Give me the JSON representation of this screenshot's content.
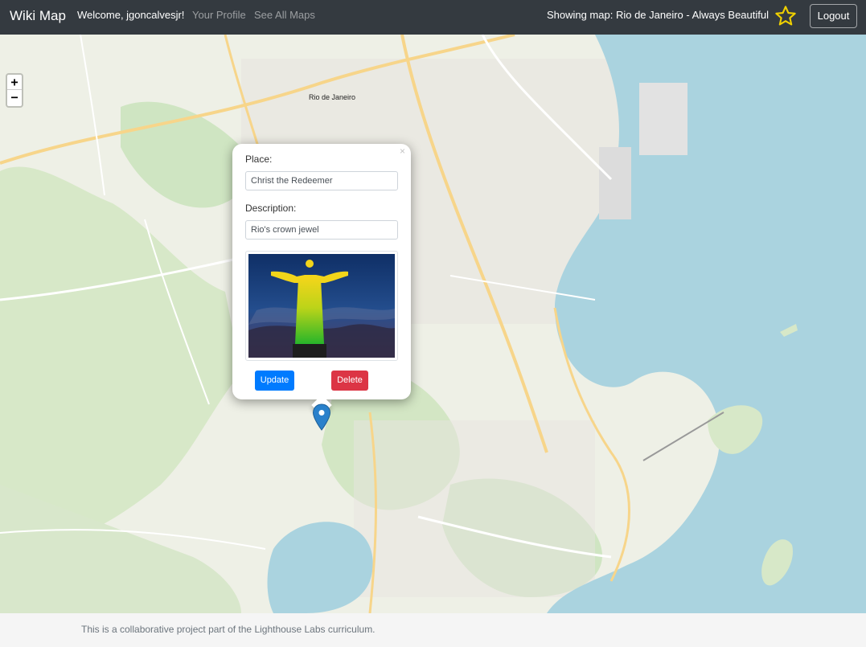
{
  "navbar": {
    "brand": "Wiki Map",
    "welcome": "Welcome, jgoncalvesjr!",
    "links": {
      "profile": "Your Profile",
      "all_maps": "See All Maps"
    },
    "showing_map": "Showing map: Rio de Janeiro - Always Beautiful",
    "favorite_icon": "star-outline-icon",
    "favorite_color": "#f0d000",
    "logout_label": "Logout",
    "background_color": "#343a40"
  },
  "map": {
    "zoom": {
      "in_label": "+",
      "out_label": "−"
    },
    "place_label": "Rio de Janeiro",
    "water_color": "#aad3df",
    "land_color": "#eef0e6",
    "park_color": "#cfe5c2",
    "marker_icon": "map-marker-icon",
    "marker_color": "#2a81cb"
  },
  "popup": {
    "close_label": "×",
    "place_label": "Place:",
    "place_value": "Christ the Redeemer",
    "description_label": "Description:",
    "description_value": "Rio's crown jewel",
    "image_icon": "christ-the-redeemer-photo",
    "update_label": "Update",
    "delete_label": "Delete",
    "update_color": "#007bff",
    "delete_color": "#dc3545"
  },
  "footer": {
    "text": "This is a collaborative project part of the Lighthouse Labs curriculum."
  }
}
